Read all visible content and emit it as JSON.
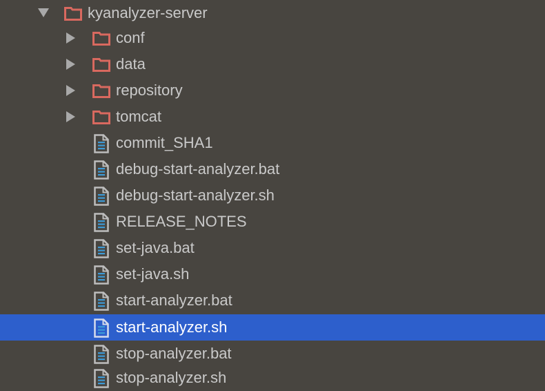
{
  "project_tree": {
    "root": {
      "label": "kyanalyzer-server",
      "expanded": true,
      "icon": "folder-icon",
      "children": [
        {
          "label": "conf",
          "type": "folder",
          "icon": "folder-icon",
          "expanded": false
        },
        {
          "label": "data",
          "type": "folder",
          "icon": "folder-icon",
          "expanded": false
        },
        {
          "label": "repository",
          "type": "folder",
          "icon": "folder-icon",
          "expanded": false
        },
        {
          "label": "tomcat",
          "type": "folder",
          "icon": "folder-icon",
          "expanded": false
        },
        {
          "label": "commit_SHA1",
          "type": "file",
          "icon": "text-file-icon"
        },
        {
          "label": "debug-start-analyzer.bat",
          "type": "file",
          "icon": "text-file-icon"
        },
        {
          "label": "debug-start-analyzer.sh",
          "type": "file",
          "icon": "text-file-icon"
        },
        {
          "label": "RELEASE_NOTES",
          "type": "file",
          "icon": "text-file-icon"
        },
        {
          "label": "set-java.bat",
          "type": "file",
          "icon": "text-file-icon"
        },
        {
          "label": "set-java.sh",
          "type": "file",
          "icon": "text-file-icon"
        },
        {
          "label": "start-analyzer.bat",
          "type": "file",
          "icon": "text-file-icon"
        },
        {
          "label": "start-analyzer.sh",
          "type": "file",
          "icon": "text-file-icon",
          "selected": true
        },
        {
          "label": "stop-analyzer.bat",
          "type": "file",
          "icon": "text-file-icon"
        },
        {
          "label": "stop-analyzer.sh",
          "type": "file",
          "icon": "text-file-icon"
        }
      ]
    }
  },
  "colors": {
    "background": "#484540",
    "selection": "#2d5fcc",
    "folder_icon": "#d9695f",
    "file_icon_outline": "#bdbdbd",
    "file_icon_lines": "#3d9ad6",
    "text": "#c9c9c9",
    "selected_text": "#ffffff",
    "arrow": "#a9a9a9"
  }
}
